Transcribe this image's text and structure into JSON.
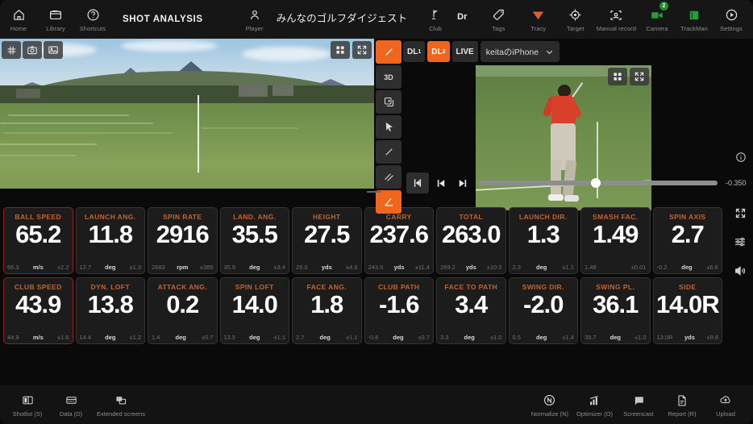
{
  "header": {
    "title": "SHOT ANALYSIS",
    "left_nav": [
      {
        "label": "Home",
        "icon": "home-icon"
      },
      {
        "label": "Library",
        "icon": "folder-icon"
      },
      {
        "label": "Shortcuts",
        "icon": "question-circle-icon"
      }
    ],
    "player": {
      "label": "Player",
      "name": "みんなのゴルフダイジェスト",
      "icon": "person-icon"
    },
    "club": {
      "label": "Club",
      "value": "Dr",
      "icon": "club-icon"
    },
    "tags": {
      "label": "Tags",
      "icon": "tag-icon"
    },
    "right_nav": [
      {
        "label": "Tracy",
        "icon": "tracy-icon",
        "color": "#e8632a"
      },
      {
        "label": "Target",
        "icon": "target-icon"
      },
      {
        "label": "Manual record",
        "icon": "manual-record-icon"
      },
      {
        "label": "Camera",
        "icon": "camera-icon",
        "badge": "2",
        "color": "#2a9b3a"
      },
      {
        "label": "TrackMan",
        "icon": "trackman-icon",
        "color": "#2a9b3a"
      },
      {
        "label": "Settings",
        "icon": "settings-icon"
      }
    ]
  },
  "video": {
    "left_overlay_tools": [
      {
        "icon": "grid-hash-icon"
      },
      {
        "icon": "camera-snapshot-icon"
      },
      {
        "icon": "image-icon"
      }
    ],
    "left_corner_tools": [
      {
        "icon": "layout-grid-icon"
      },
      {
        "icon": "expand-icon"
      }
    ],
    "draw_tools": [
      {
        "icon": "3d-icon",
        "label": "3D",
        "active": false
      },
      {
        "icon": "duplicate-icon",
        "label": "",
        "active": false
      },
      {
        "icon": "cursor-icon",
        "label": "",
        "active": false
      },
      {
        "icon": "line-icon",
        "label": "",
        "active": false
      },
      {
        "icon": "parallel-lines-icon",
        "label": "",
        "active": false
      },
      {
        "icon": "angle-icon",
        "label": "",
        "active": true
      }
    ],
    "pen_tool": {
      "icon": "pen-icon",
      "active": true
    },
    "sources": [
      {
        "label": "DL",
        "sub": "1",
        "active": false
      },
      {
        "label": "DL",
        "sub": "2",
        "active": true
      },
      {
        "label": "LIVE",
        "sub": "",
        "active": false
      }
    ],
    "device_select": {
      "value": "keitaのiPhone",
      "icon": "chevron-down-icon"
    },
    "right_corner_tools": [
      {
        "icon": "layout-grid-icon"
      },
      {
        "icon": "expand-icon"
      }
    ],
    "info_icon": "info-icon",
    "player_controls": [
      {
        "icon": "frame-marker-icon"
      },
      {
        "icon": "step-back-icon"
      },
      {
        "icon": "step-forward-icon"
      }
    ],
    "timestamp": "-0.350"
  },
  "metrics": {
    "rows": [
      [
        {
          "label": "BALL SPEED",
          "value": "65.2",
          "avg": "66.3",
          "unit": "m/s",
          "dev": "±2.2",
          "highlight": true
        },
        {
          "label": "LAUNCH ANG.",
          "value": "11.8",
          "avg": "12.7",
          "unit": "deg",
          "dev": "±1.3",
          "highlight": false
        },
        {
          "label": "SPIN RATE",
          "value": "2916",
          "avg": "2683",
          "unit": "rpm",
          "dev": "±385",
          "highlight": false
        },
        {
          "label": "LAND. ANG.",
          "value": "35.5",
          "avg": "35.9",
          "unit": "deg",
          "dev": "±3.4",
          "highlight": false
        },
        {
          "label": "HEIGHT",
          "value": "27.5",
          "avg": "29.0",
          "unit": "yds",
          "dev": "±4.6",
          "highlight": false
        },
        {
          "label": "CARRY",
          "value": "237.6",
          "avg": "243.5",
          "unit": "yds",
          "dev": "±11.4",
          "highlight": false
        },
        {
          "label": "TOTAL",
          "value": "263.0",
          "avg": "269.2",
          "unit": "yds",
          "dev": "±10.0",
          "highlight": false
        },
        {
          "label": "LAUNCH DIR.",
          "value": "1.3",
          "avg": "2.3",
          "unit": "deg",
          "dev": "±1.1",
          "highlight": false
        },
        {
          "label": "SMASH FAC.",
          "value": "1.49",
          "avg": "1.48",
          "unit": "",
          "dev": "±0.01",
          "highlight": false
        },
        {
          "label": "SPIN AXIS",
          "value": "2.7",
          "avg": "-0.2",
          "unit": "deg",
          "dev": "±6.6",
          "highlight": false
        }
      ],
      [
        {
          "label": "CLUB SPEED",
          "value": "43.9",
          "avg": "44.9",
          "unit": "m/s",
          "dev": "±1.6",
          "highlight": true
        },
        {
          "label": "DYN. LOFT",
          "value": "13.8",
          "avg": "14.4",
          "unit": "deg",
          "dev": "±1.2",
          "highlight": false
        },
        {
          "label": "ATTACK ANG.",
          "value": "0.2",
          "avg": "1.4",
          "unit": "deg",
          "dev": "±0.7",
          "highlight": false
        },
        {
          "label": "SPIN LOFT",
          "value": "14.0",
          "avg": "13.5",
          "unit": "deg",
          "dev": "±1.1",
          "highlight": false
        },
        {
          "label": "FACE ANG.",
          "value": "1.8",
          "avg": "2.7",
          "unit": "deg",
          "dev": "±1.1",
          "highlight": false
        },
        {
          "label": "CLUB PATH",
          "value": "-1.6",
          "avg": "-0.6",
          "unit": "deg",
          "dev": "±0.7",
          "highlight": false
        },
        {
          "label": "FACE TO PATH",
          "value": "3.4",
          "avg": "3.3",
          "unit": "deg",
          "dev": "±1.0",
          "highlight": false
        },
        {
          "label": "SWING DIR.",
          "value": "-2.0",
          "avg": "0.5",
          "unit": "deg",
          "dev": "±1.4",
          "highlight": false
        },
        {
          "label": "SWING PL.",
          "value": "36.1",
          "avg": "35.7",
          "unit": "deg",
          "dev": "±1.0",
          "highlight": false
        },
        {
          "label": "SIDE",
          "value": "14.0R",
          "avg": "13.0R",
          "unit": "yds",
          "dev": "±9.6",
          "highlight": false
        }
      ]
    ],
    "side_tools": [
      {
        "icon": "expand-icon"
      },
      {
        "icon": "sliders-icon"
      },
      {
        "icon": "volume-icon"
      }
    ]
  },
  "footer": {
    "left": [
      {
        "label": "Shotlist (S)",
        "icon": "shotlist-icon"
      },
      {
        "label": "Data (D)",
        "icon": "data-icon"
      },
      {
        "label": "Extended screens",
        "icon": "extended-screens-icon"
      }
    ],
    "right": [
      {
        "label": "Normalize (N)",
        "icon": "normalize-icon"
      },
      {
        "label": "Optimizer (O)",
        "icon": "optimizer-icon"
      },
      {
        "label": "Screencast",
        "icon": "screencast-icon"
      },
      {
        "label": "Report (R)",
        "icon": "report-icon"
      },
      {
        "label": "Upload",
        "icon": "upload-icon"
      }
    ]
  },
  "colors": {
    "accent_orange": "#f0661f",
    "label_orange": "#c4642a",
    "highlight_red": "#8c2020",
    "green": "#2a9b3a"
  }
}
